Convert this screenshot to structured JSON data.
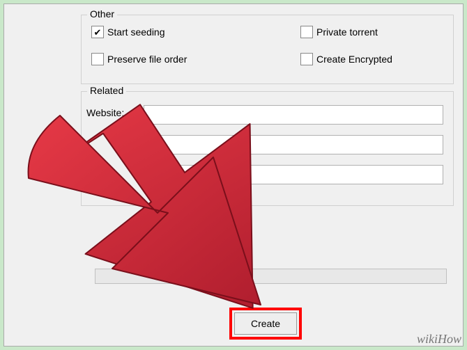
{
  "other": {
    "legend": "Other",
    "start_seeding": {
      "label": "Start seeding",
      "checked": true
    },
    "private_torrent": {
      "label": "Private torrent",
      "checked": false
    },
    "preserve_file_order": {
      "label": "Preserve file order",
      "checked": false
    },
    "create_encrypted": {
      "label": "Create Encrypted",
      "checked": false
    }
  },
  "related": {
    "legend": "Related",
    "website_label": "Website:",
    "website_value": "",
    "field2_value": "",
    "field3_value": ""
  },
  "buttons": {
    "create": "Create"
  },
  "watermark": "wikiHow",
  "highlight_color": "#ff0000"
}
